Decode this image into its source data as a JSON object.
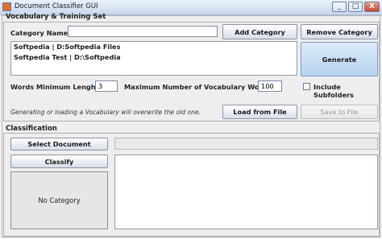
{
  "window": {
    "title": "Document Classifier GUI",
    "minimize": "_",
    "maximize": "□",
    "close": "X"
  },
  "vocab": {
    "section_title": "Vocabulary & Training Set",
    "category_name_label": "Category Name:",
    "category_name_value": "",
    "add_category": "Add Category",
    "remove_category": "Remove Category",
    "categories": [
      "Softpedia | D:Softpedia Files",
      "Softpedia Test | D:\\Softpedia"
    ],
    "generate": "Generate",
    "words_min_label": "Words Minimum Lenght:",
    "words_min_value": "3",
    "max_vocab_label": "Maximum Number of Vocabulary Words:",
    "max_vocab_value": "100",
    "include_subfolders_label": "Include Subfolders",
    "include_subfolders_checked": false,
    "note": "Generating or loading a Vocabulary will overwrite the old one.",
    "load_from_file": "Load from File",
    "save_to_file": "Save to File"
  },
  "classification": {
    "section_title": "Classification",
    "select_document": "Select Document",
    "classify": "Classify",
    "result": "No Category"
  }
}
